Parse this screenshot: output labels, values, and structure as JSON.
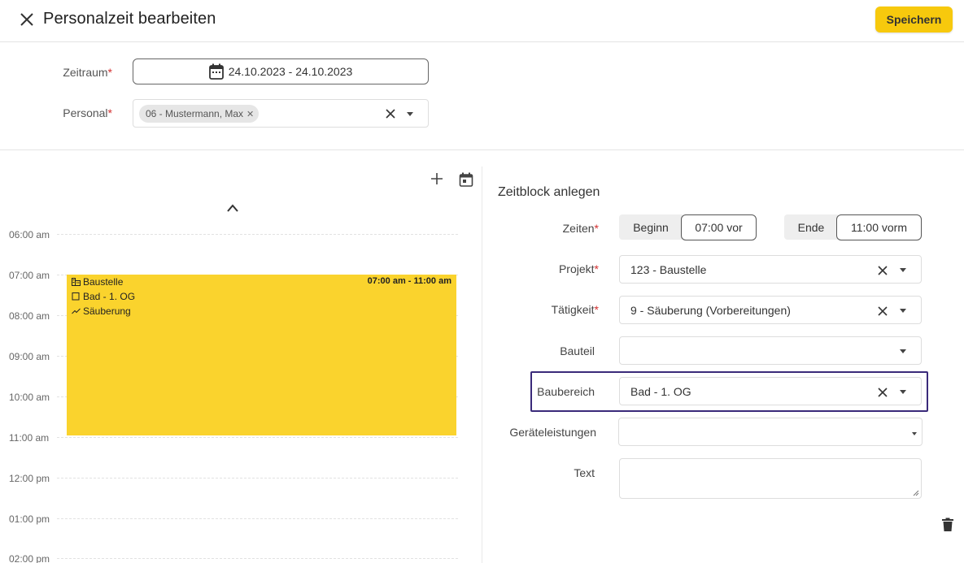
{
  "header": {
    "title": "Personalzeit bearbeiten",
    "save_label": "Speichern"
  },
  "form": {
    "zeitraum_label": "Zeitraum",
    "zeitraum_value": "24.10.2023 - 24.10.2023",
    "personal_label": "Personal",
    "personal_chip": "06 - Mustermann, Max",
    "required_mark": "*"
  },
  "calendar": {
    "hours": [
      "06:00 am",
      "07:00 am",
      "08:00 am",
      "09:00 am",
      "10:00 am",
      "11:00 am",
      "12:00 pm",
      "01:00 pm",
      "02:00 pm"
    ],
    "event": {
      "time": "07:00 am - 11:00 am",
      "project": "Baustelle",
      "area": "Bad - 1. OG",
      "activity": "Säuberung",
      "color": "#fad32d"
    }
  },
  "zeitblock": {
    "title": "Zeitblock anlegen",
    "zeiten_label": "Zeiten",
    "beginn_label": "Beginn",
    "beginn_value": "07:00 vor",
    "ende_label": "Ende",
    "ende_value": "11:00 vorm",
    "projekt_label": "Projekt",
    "projekt_value": "123 - Baustelle",
    "taetigkeit_label": "Tätigkeit",
    "taetigkeit_value": "9 - Säuberung (Vorbereitungen)",
    "bauteil_label": "Bauteil",
    "bauteil_value": "",
    "baubereich_label": "Baubereich",
    "baubereich_value": "Bad - 1. OG",
    "geraete_label": "Geräteleistungen",
    "geraete_value": "",
    "text_label": "Text"
  },
  "colors": {
    "accent": "#f7c90d",
    "event": "#fad32d",
    "highlight": "#3a2a7a",
    "required": "#d32f2f"
  }
}
